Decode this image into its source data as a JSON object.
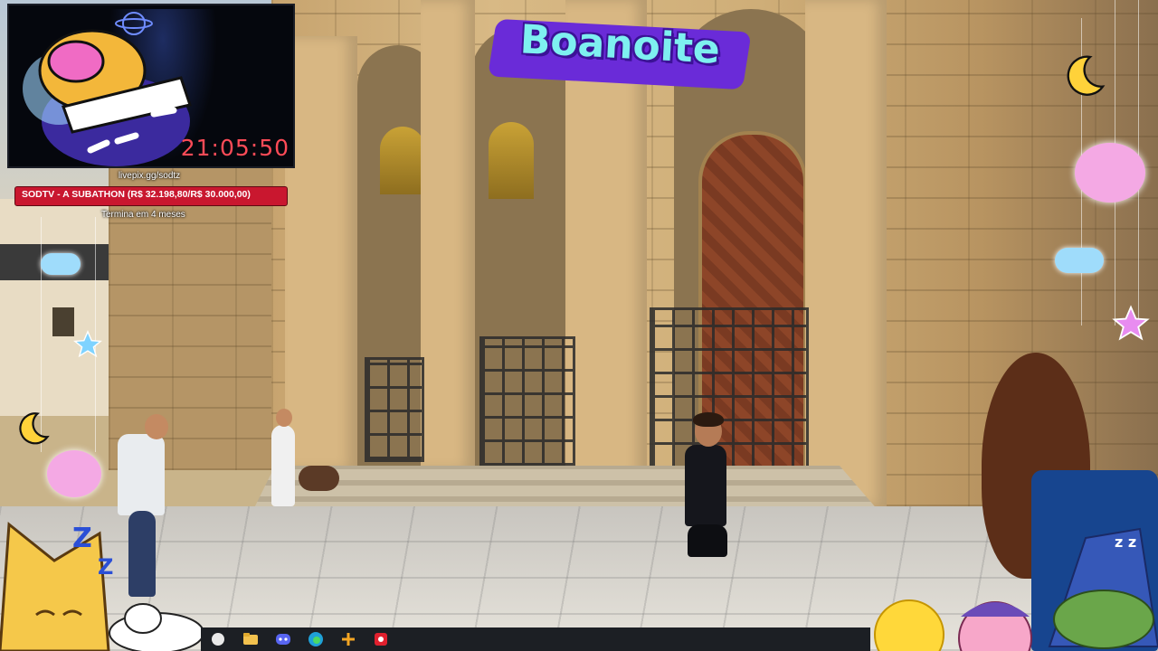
{
  "webcam": {
    "timer": "21:05:50"
  },
  "donation": {
    "link": "livepix.gg/sodtz",
    "goal_label": "SODTV - A SUBATHON (R$ 32.198,80/R$ 30.000,00)",
    "goal_progress": 1.0,
    "ends": "Termina em 4 meses"
  },
  "greeting": {
    "text": "Boanoite"
  },
  "colors": {
    "goal_bar": "#c9172f",
    "timer": "#ff4b57",
    "greeting_text": "#7ef0f0",
    "greeting_back": "#6a2bd8"
  },
  "taskbar": {
    "icons": [
      "windows-start-icon",
      "file-explorer-icon",
      "discord-icon",
      "edge-browser-icon",
      "tools-app-icon",
      "record-app-icon"
    ]
  }
}
